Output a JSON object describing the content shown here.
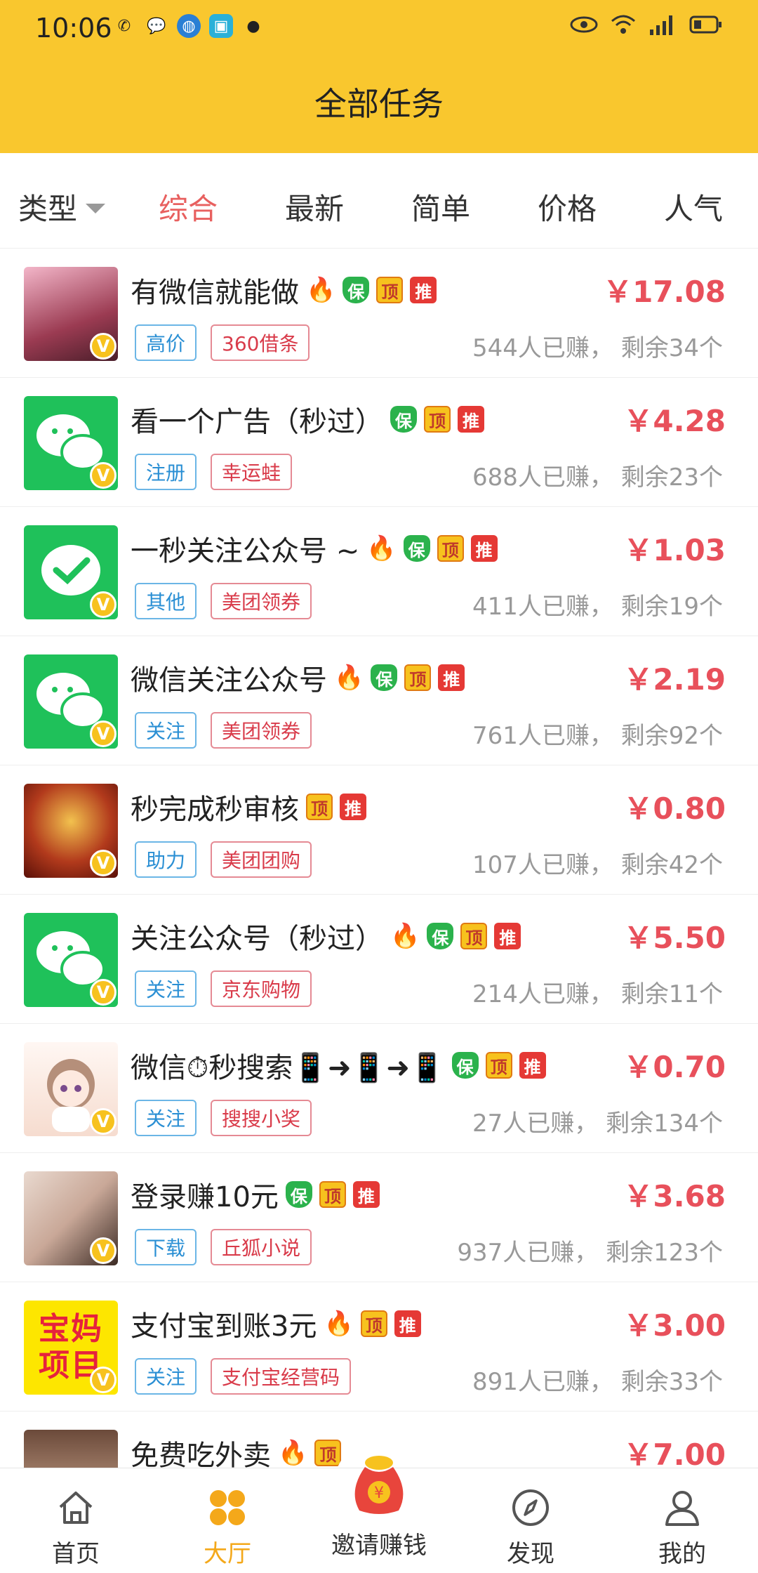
{
  "status": {
    "time": "10:06"
  },
  "header": {
    "title": "全部任务"
  },
  "filter": {
    "type_label": "类型",
    "tabs": [
      "综合",
      "最新",
      "简单",
      "价格",
      "人气"
    ]
  },
  "badges": {
    "bao": "保",
    "ding": "顶",
    "tui": "推",
    "v": "V"
  },
  "tasks": [
    {
      "title": "有微信就能做",
      "fire": true,
      "bao": true,
      "price": "￥17.08",
      "tag1": "高价",
      "tag2": "360借条",
      "stats": "544人已赚，  剩余34个"
    },
    {
      "title": "看一个广告（秒过）",
      "fire": false,
      "bao": true,
      "price": "￥4.28",
      "tag1": "注册",
      "tag2": "幸运蛙",
      "stats": "688人已赚，  剩余23个"
    },
    {
      "title": "一秒关注公众号 ~",
      "fire": true,
      "bao": true,
      "price": "￥1.03",
      "tag1": "其他",
      "tag2": "美团领券",
      "stats": "411人已赚，  剩余19个"
    },
    {
      "title": "微信关注公众号",
      "fire": true,
      "bao": true,
      "price": "￥2.19",
      "tag1": "关注",
      "tag2": "美团领券",
      "stats": "761人已赚，  剩余92个"
    },
    {
      "title": "秒完成秒审核",
      "fire": false,
      "bao": false,
      "price": "￥0.80",
      "tag1": "助力",
      "tag2": "美团团购",
      "stats": "107人已赚，  剩余42个"
    },
    {
      "title": "关注公众号（秒过）",
      "fire": true,
      "bao": true,
      "price": "￥5.50",
      "tag1": "关注",
      "tag2": "京东购物",
      "stats": "214人已赚，  剩余11个"
    },
    {
      "title": "微信⏱秒搜索📱➜📱➜📱",
      "fire": false,
      "bao": true,
      "price": "￥0.70",
      "tag1": "关注",
      "tag2": "搜搜小奖",
      "stats": "27人已赚，  剩余134个"
    },
    {
      "title": "登录赚10元",
      "fire": false,
      "bao": true,
      "price": "￥3.68",
      "tag1": "下载",
      "tag2": "丘狐小说",
      "stats": "937人已赚，  剩余123个"
    },
    {
      "title": "支付宝到账3元",
      "fire": true,
      "bao": false,
      "price": "￥3.00",
      "tag1": "关注",
      "tag2": "支付宝经营码",
      "stats": "891人已赚，  剩余33个"
    },
    {
      "title": "免费吃外卖",
      "fire": true,
      "bao": false,
      "price": "￥7.00",
      "tag1": "",
      "tag2": "",
      "stats": ""
    }
  ],
  "avatar_text_9": "宝妈项目",
  "nav": {
    "home": "首页",
    "hall": "大厅",
    "invite": "邀请赚钱",
    "discover": "发现",
    "mine": "我的"
  }
}
